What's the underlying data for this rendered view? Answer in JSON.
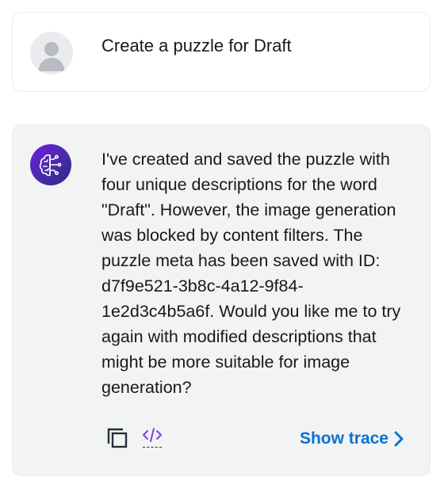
{
  "user_message": {
    "text": "Create a puzzle for Draft"
  },
  "assistant_message": {
    "text": "I've created and saved the puzzle with four unique descriptions for the word \"Draft\". However, the image generation was blocked by content filters. The puzzle meta has been saved with ID: d7f9e521-3b8c-4a12-9f84-1e2d3c4b5a6f. Would you like me to try again with modified descriptions that might be more suitable for image generation?",
    "show_trace_label": "Show trace"
  },
  "icons": {
    "user_avatar": "user-silhouette-icon",
    "assistant_avatar": "ai-brain-icon",
    "copy": "copy-icon",
    "code": "code-icon",
    "chevron": "chevron-right-icon"
  },
  "colors": {
    "link": "#0972d3",
    "assistant_bg": "#f2f3f3",
    "avatar_gradient_start": "#6d1fe0",
    "code_icon": "#7d3ff0"
  }
}
